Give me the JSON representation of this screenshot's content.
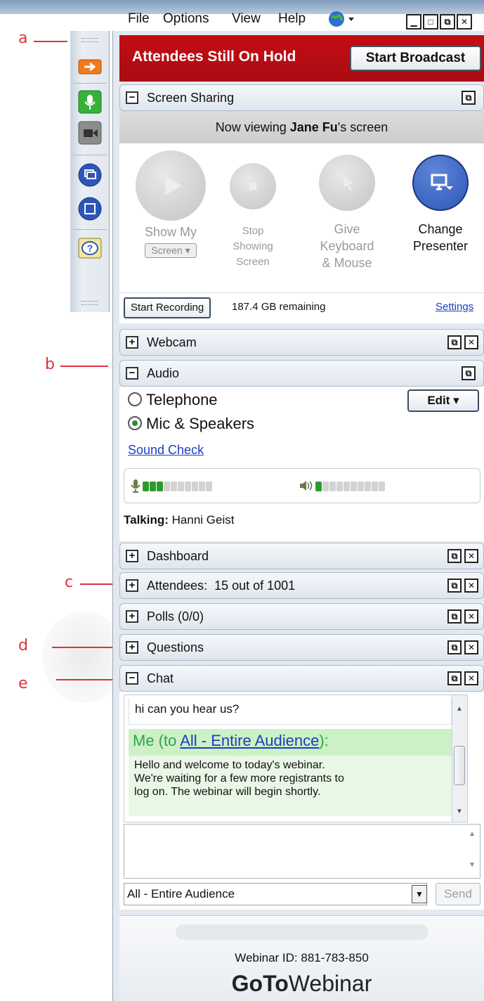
{
  "callouts": [
    "a",
    "b",
    "c",
    "d",
    "e"
  ],
  "menu": {
    "file": "File",
    "options": "Options",
    "view": "View",
    "help": "Help",
    "globe_icon": "globe-icon",
    "window_buttons": [
      "minimize",
      "restore",
      "popout",
      "close"
    ]
  },
  "grabtab": {
    "icons": [
      "arrow-icon",
      "microphone-icon",
      "webcam-icon",
      "screen-share-icon",
      "window-icon",
      "help-icon"
    ]
  },
  "hold": {
    "title": "Attendees Still On Hold",
    "start_broadcast": "Start Broadcast"
  },
  "screen_sharing": {
    "header": "Screen Sharing",
    "viewing_prefix": "Now viewing ",
    "viewing_name": "Jane Fu",
    "viewing_suffix": "'s screen",
    "show_my": "Show My",
    "screen_dropdown": "Screen ▾",
    "stop_1": "Stop",
    "stop_2": "Showing",
    "stop_3": "Screen",
    "give_1": "Give",
    "give_2": "Keyboard",
    "give_3": "& Mouse",
    "change_1": "Change",
    "change_2": "Presenter",
    "start_recording": "Start Recording",
    "remaining": "187.4 GB remaining",
    "settings": "Settings"
  },
  "webcam": {
    "header": "Webcam"
  },
  "audio": {
    "header": "Audio",
    "telephone": "Telephone",
    "mic_speakers": "Mic & Speakers",
    "selected": "Mic & Speakers",
    "edit": "Edit ▾",
    "sound_check": "Sound Check",
    "mic_level": 3,
    "speaker_level": 1,
    "segments": 10,
    "talking_label": "Talking:",
    "talking_name": "Hanni Geist"
  },
  "dashboard": {
    "header": "Dashboard"
  },
  "attendees": {
    "header": "Attendees:  15 out of 1001"
  },
  "polls": {
    "header": "Polls (0/0)"
  },
  "questions": {
    "header": "Questions"
  },
  "chat": {
    "header": "Chat",
    "prev_message": "hi can you hear us?",
    "sender": "Me",
    "to_prefix": " (to ",
    "to_link": "All - Entire Audience",
    "to_suffix": "):",
    "message_1": "Hello and welcome to today's webinar.",
    "message_2": "We're waiting for a few more registrants to",
    "message_3": "log on. The webinar will begin shortly.",
    "recipient": "All - Entire Audience",
    "send": "Send"
  },
  "footer": {
    "webinar_id": "Webinar ID: 881-783-850",
    "logo_bold": "GoTo",
    "logo_light": "Webinar"
  },
  "colors": {
    "hold_red": "#c40d15",
    "accent_blue": "#2d56b8",
    "green": "#2c9b2c",
    "link": "#1a3fbf"
  }
}
